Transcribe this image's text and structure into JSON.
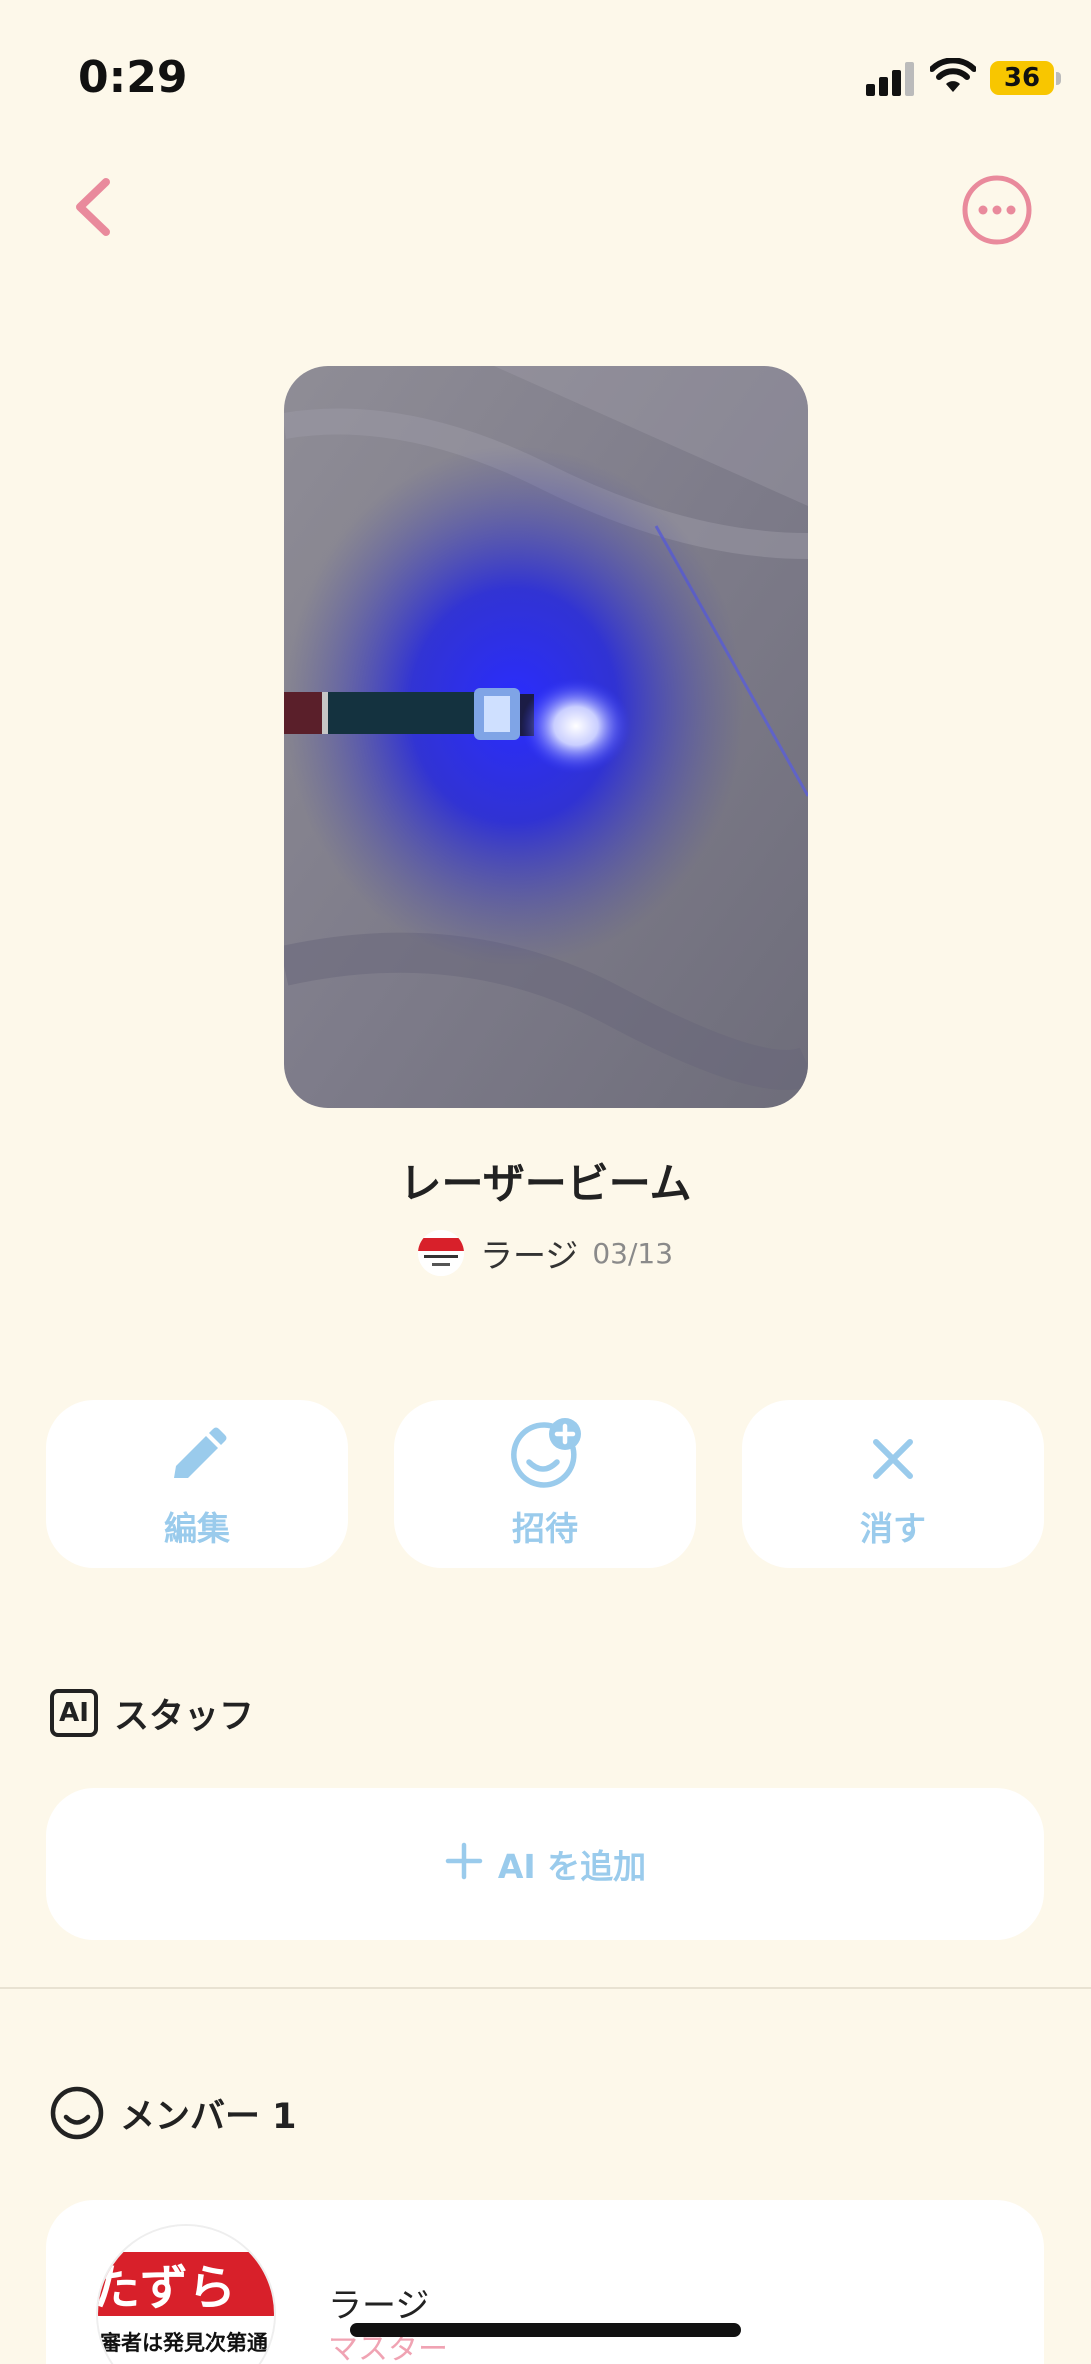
{
  "status_bar": {
    "time": "0:29",
    "battery": "36",
    "battery_color": "#f8c600",
    "icons": [
      "signal-icon",
      "wifi-icon",
      "battery-icon"
    ]
  },
  "nav": {
    "back_icon": "chevron-left-icon",
    "more_icon": "more-horizontal-icon",
    "accent_color": "#e98a9c"
  },
  "post": {
    "image": "blue-laser-pointer-photo",
    "title": "レーザービーム",
    "author_name": "ラージ",
    "date": "03/13"
  },
  "actions": [
    {
      "label": "編集",
      "icon": "pencil-icon"
    },
    {
      "label": "招待",
      "icon": "invite-smile-plus-icon"
    },
    {
      "label": "消す",
      "icon": "close-icon"
    }
  ],
  "staff_section": {
    "badge": "AI",
    "title": "スタッフ",
    "add_label": "AI を追加",
    "add_icon": "plus-icon"
  },
  "member_section": {
    "icon": "smile-icon",
    "title": "メンバー 1",
    "members": [
      {
        "name": "ラージ",
        "role": "マスター"
      }
    ]
  },
  "avatar_text": {
    "line1": "たずら",
    "line2": "審者は発見次第通"
  },
  "accent_blue": "#9acbec"
}
